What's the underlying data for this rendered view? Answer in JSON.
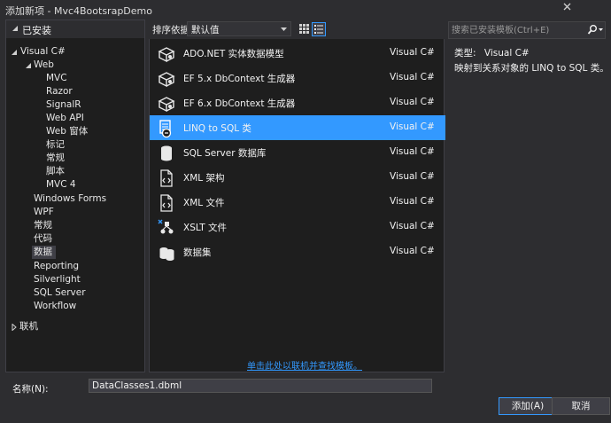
{
  "window": {
    "title": "添加新项 - Mvc4BootsrapDemo"
  },
  "installed": {
    "label": "已安装"
  },
  "tree": [
    {
      "label": "Visual C#",
      "expanded": true
    },
    {
      "label": "Web",
      "expanded": true
    },
    {
      "label": "MVC"
    },
    {
      "label": "Razor"
    },
    {
      "label": "SignalR"
    },
    {
      "label": "Web API"
    },
    {
      "label": "Web 窗体"
    },
    {
      "label": "标记"
    },
    {
      "label": "常规"
    },
    {
      "label": "脚本"
    },
    {
      "label": "MVC 4"
    },
    {
      "label": "Windows Forms"
    },
    {
      "label": "WPF"
    },
    {
      "label": "常规"
    },
    {
      "label": "代码"
    },
    {
      "label": "数据",
      "selected": true
    },
    {
      "label": "Reporting"
    },
    {
      "label": "Silverlight"
    },
    {
      "label": "SQL Server"
    },
    {
      "label": "Workflow"
    },
    {
      "label": "联机",
      "expanded": false
    }
  ],
  "sort": {
    "label": "排序依据:",
    "value": "默认值"
  },
  "templates": [
    {
      "name": "ADO.NET 实体数据模型",
      "type": "Visual C#",
      "icon": "entity-model-icon"
    },
    {
      "name": "EF 5.x DbContext 生成器",
      "type": "Visual C#",
      "icon": "ef-generator-icon"
    },
    {
      "name": "EF 6.x DbContext 生成器",
      "type": "Visual C#",
      "icon": "ef-generator-icon"
    },
    {
      "name": "LINQ to SQL 类",
      "type": "Visual C#",
      "icon": "linq-to-sql-icon",
      "selected": true
    },
    {
      "name": "SQL Server 数据库",
      "type": "Visual C#",
      "icon": "database-icon"
    },
    {
      "name": "XML 架构",
      "type": "Visual C#",
      "icon": "xml-schema-icon"
    },
    {
      "name": "XML 文件",
      "type": "Visual C#",
      "icon": "xml-file-icon"
    },
    {
      "name": "XSLT 文件",
      "type": "Visual C#",
      "icon": "xslt-file-icon"
    },
    {
      "name": "数据集",
      "type": "Visual C#",
      "icon": "dataset-icon"
    }
  ],
  "online_link": "单击此处以联机并查找模板。",
  "search": {
    "placeholder": "搜索已安装模板(Ctrl+E)"
  },
  "details": {
    "type_label": "类型:",
    "type_value": "Visual C#",
    "description": "映射到关系对象的 LINQ to SQL 类。"
  },
  "name_field": {
    "label": "名称(N):",
    "value": "DataClasses1.dbml"
  },
  "buttons": {
    "add": "添加(A)",
    "cancel": "取消"
  },
  "colors": {
    "accent": "#3399ff",
    "background": "#2d2d30",
    "panel": "#1e1e1e"
  }
}
